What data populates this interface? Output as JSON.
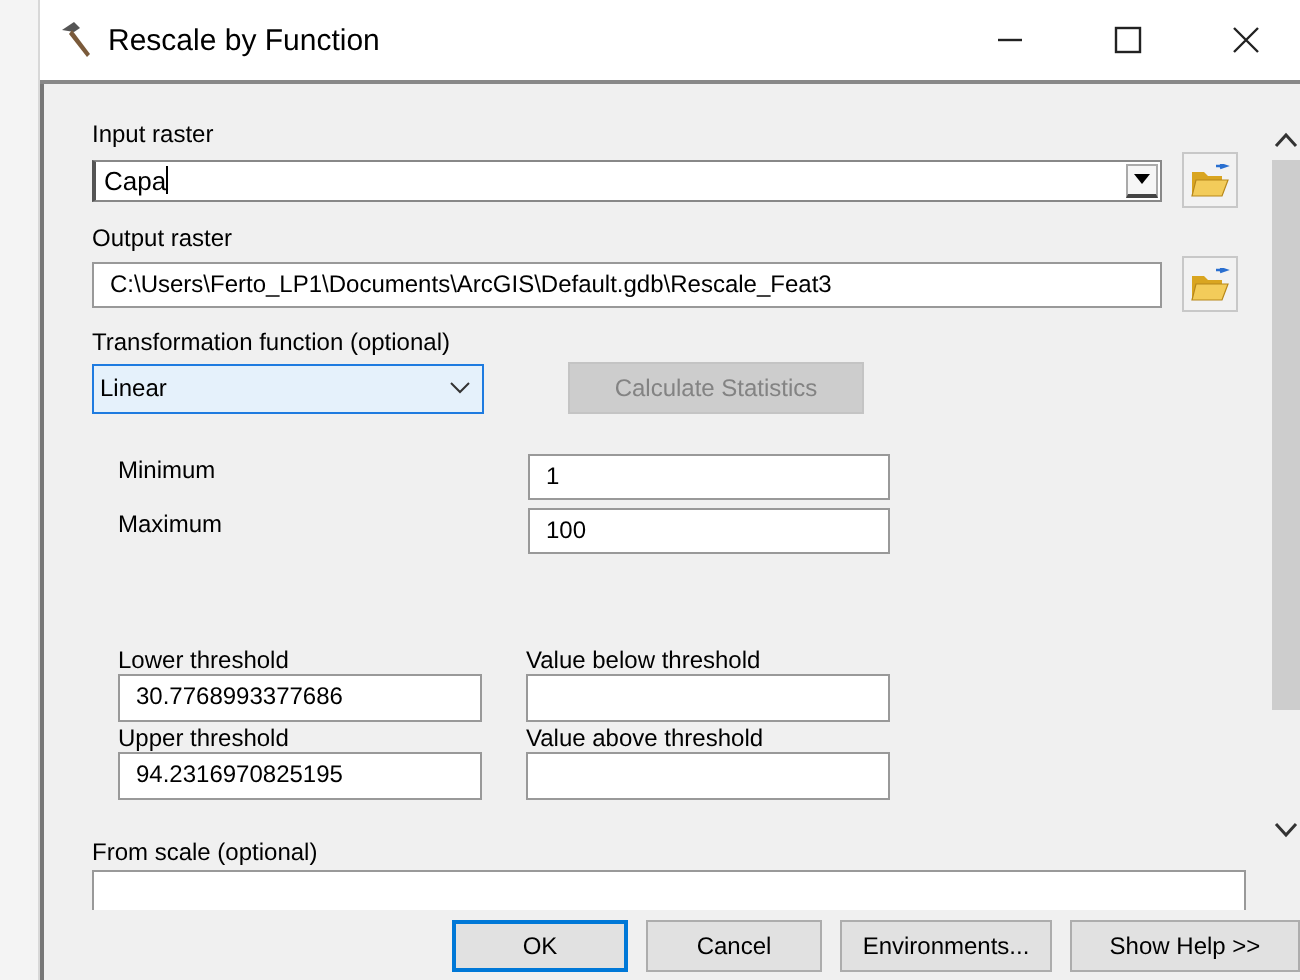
{
  "window": {
    "title": "Rescale by Function"
  },
  "input_raster": {
    "label": "Input raster",
    "value": "Capa"
  },
  "output_raster": {
    "label": "Output raster",
    "value": "C:\\Users\\Ferto_LP1\\Documents\\ArcGIS\\Default.gdb\\Rescale_Feat3"
  },
  "transformation": {
    "label": "Transformation function (optional)",
    "value": "Linear",
    "button": {
      "label": "Calculate Statistics",
      "disabled": true
    }
  },
  "range": [
    {
      "label": "Minimum",
      "value": "1"
    },
    {
      "label": "Maximum",
      "value": "100"
    }
  ],
  "thresholds": [
    {
      "label": "Lower threshold",
      "value": "30.7768993377686",
      "other_label": "Value below threshold"
    },
    {
      "label": "Upper threshold",
      "value": "94.2316970825195",
      "other_label": "Value above threshold"
    }
  ],
  "from_scale": {
    "label": "From scale (optional)"
  },
  "buttons": [
    {
      "label": "OK",
      "default": true
    },
    {
      "label": "Cancel",
      "default": false
    },
    {
      "label": "Environments...",
      "default": false
    },
    {
      "label": "Show Help >>",
      "default": false
    }
  ]
}
